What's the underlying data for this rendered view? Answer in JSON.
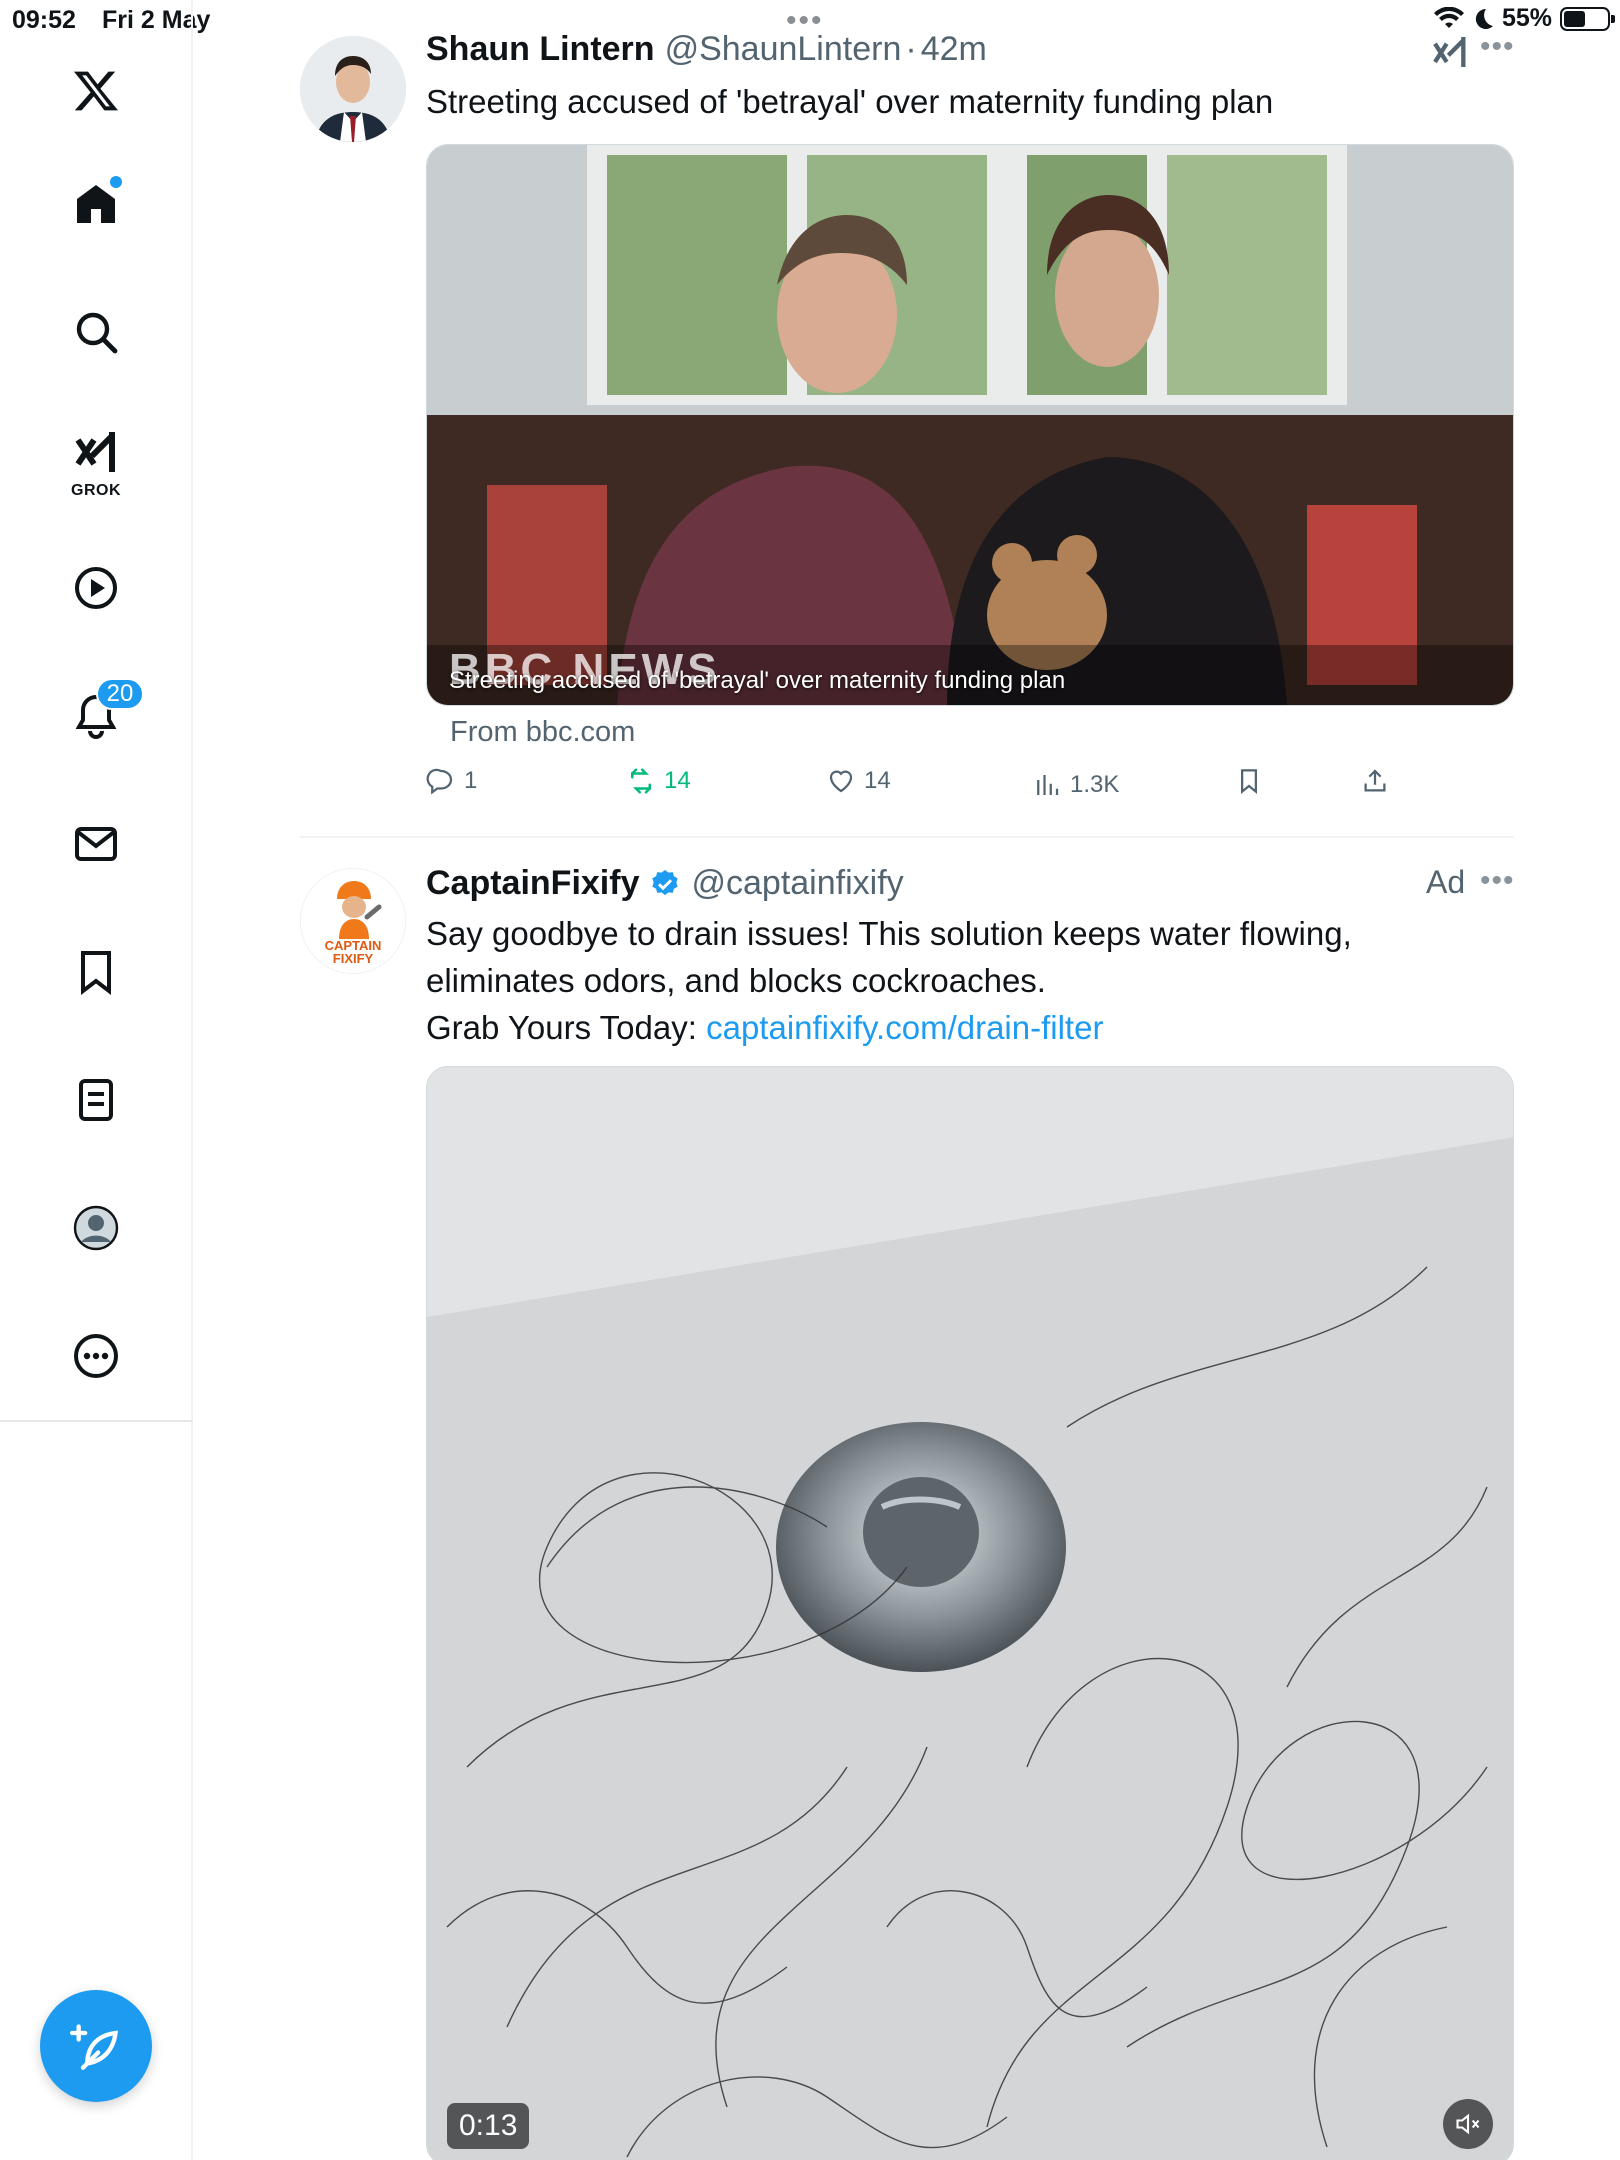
{
  "status_bar": {
    "time": "09:52",
    "date": "Fri 2 May",
    "battery": "55%",
    "battery_level": 0.55
  },
  "sidebar": {
    "grok_label": "GROK",
    "notifications_count": "20"
  },
  "tweets": [
    {
      "name": "Shaun Lintern",
      "handle": "@ShaunLintern",
      "sep": "·",
      "time": "42m",
      "text": "Streeting accused of 'betrayal' over maternity funding plan",
      "card_caption": "Streeting accused of 'betrayal' over maternity funding plan",
      "card_brand": "BBC NEWS",
      "card_source": "From bbc.com",
      "replies": "1",
      "reposts": "14",
      "likes": "14",
      "views": "1.3K"
    },
    {
      "name": "CaptainFixify",
      "handle": "@captainfixify",
      "ad_label": "Ad",
      "avatar_text": "CAPTAIN FIXIFY",
      "text_line1": "Say goodbye to drain issues! This solution keeps water flowing,",
      "text_line2": "eliminates odors, and blocks cockroaches.",
      "text_line3_prefix": "Grab Yours Today: ",
      "link": "captainfixify.com/drain-filter",
      "video_time": "0:13"
    }
  ],
  "colors": {
    "accent": "#1d9bf0",
    "repost_green": "#00ba7c",
    "muted": "#536471"
  }
}
